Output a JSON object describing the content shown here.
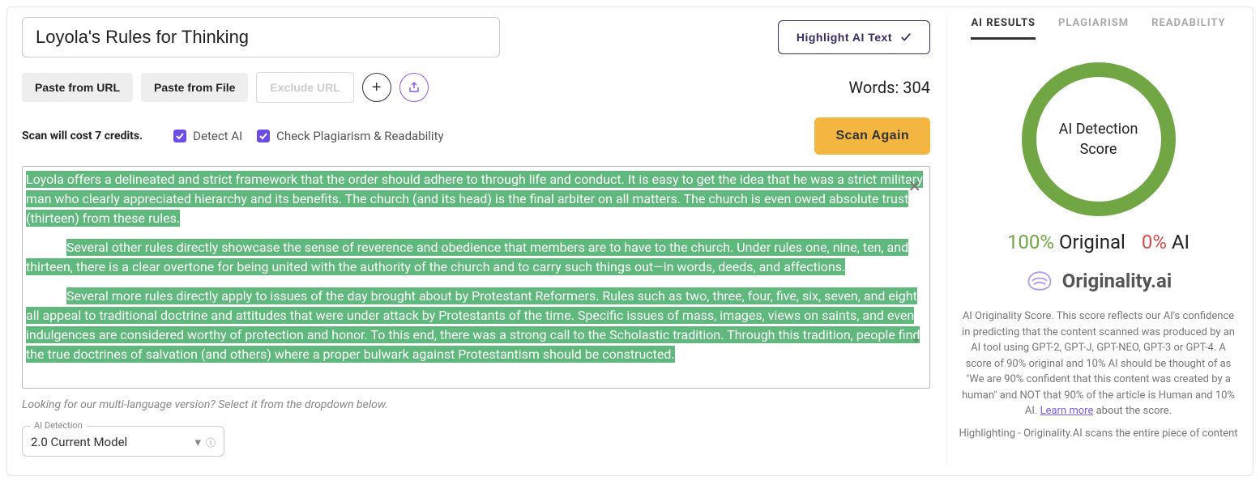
{
  "title": "Loyola's Rules for Thinking",
  "highlight_btn": "Highlight AI Text",
  "toolbar": {
    "paste_url": "Paste from URL",
    "paste_file": "Paste from File",
    "exclude_url": "Exclude URL"
  },
  "words_label": "Words: 304",
  "credits_label": "Scan will cost 7 credits.",
  "opt_detect": "Detect AI",
  "opt_plag": "Check Plagiarism & Readability",
  "scan_btn": "Scan Again",
  "content": {
    "p1": "Loyola offers a delineated and strict framework that the order should adhere to through life and conduct. It is easy to get the idea that he was a strict military man who clearly appreciated hierarchy and its benefits. The church (and its head) is the final arbiter on all matters. The church is even owed absolute trust (thirteen) from these rules.",
    "p2": "Several other rules directly showcase the sense of reverence and obedience that members are to have to the church. Under rules one, nine, ten, and thirteen, there is a clear overtone for being united with the authority of the church and to carry such things out—in words, deeds, and affections.",
    "p3": "Several more rules directly apply to issues of the day brought about by Protestant Reformers. Rules such as two, three, four, five, six, seven, and eight all appeal to traditional doctrine and attitudes that were under attack by Protestants of the time. Specific issues of mass, images, views on saints, and even indulgences are considered worthy of protection and honor. To this end, there was a strong call to the Scholastic tradition. Through this tradition, people find the true doctrines of salvation (and others) where a proper bulwark against Protestantism should be constructed."
  },
  "hint": "Looking for our multi-language version? Select it from the dropdown below.",
  "model": {
    "legend": "AI Detection",
    "value": "2.0 Current Model"
  },
  "tabs": {
    "results": "AI RESULTS",
    "plag": "PLAGIARISM",
    "read": "READABILITY"
  },
  "score": {
    "ring_l1": "AI Detection",
    "ring_l2": "Score",
    "orig_pct": "100%",
    "orig_lbl": "Original",
    "ai_pct": "0%",
    "ai_lbl": "AI"
  },
  "brand": "Originality.ai",
  "desc_main": "AI Originality Score. This score reflects our AI's confidence in predicting that the content scanned was produced by an AI tool using GPT-2, GPT-J, GPT-NEO, GPT-3 or GPT-4. A score of 90% original and 10% AI should be thought of as \"We are 90% confident that this content was created by a human\" and NOT that 90% of the article is Human and 10% AI. ",
  "desc_link": "Learn more",
  "desc_after": " about the score.",
  "desc_hl": "Highlighting - Originality.AI scans the entire piece of content"
}
